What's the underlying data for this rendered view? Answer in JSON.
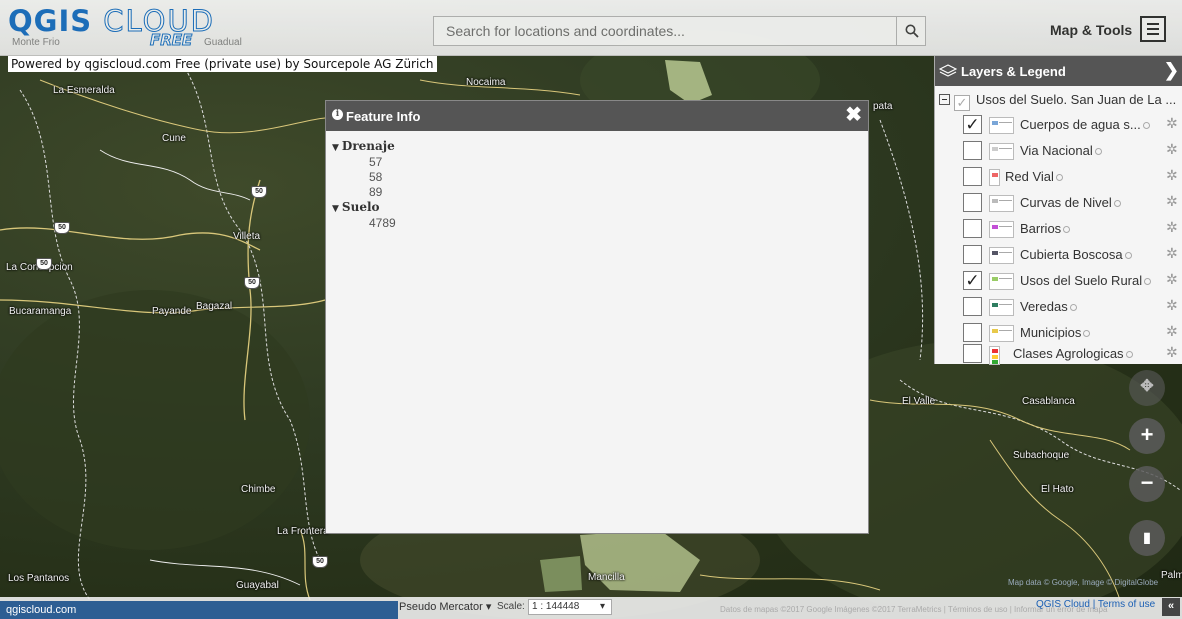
{
  "header": {
    "logo_text": "QGIS",
    "logo_cloud": "CLOUD",
    "logo_free": "FREE",
    "overlay_left": "Monte Frio",
    "overlay_right": "Guadual",
    "search_placeholder": "Search for locations and coordinates...",
    "map_tools_label": "Map & Tools"
  },
  "attribution": "Powered by qgiscloud.com Free (private use) by Sourcepole AG Zürich",
  "feature_info": {
    "title": "Feature Info",
    "groups": [
      {
        "name": "Drenaje",
        "values": [
          "57",
          "58",
          "89"
        ]
      },
      {
        "name": "Suelo",
        "values": [
          "4789"
        ]
      }
    ]
  },
  "layers_panel": {
    "title": "Layers & Legend",
    "root_label": "Usos del Suelo. San Juan de La ...",
    "layers": [
      {
        "name": "Cuerpos de agua s...",
        "checked": true
      },
      {
        "name": "Via Nacional",
        "checked": false
      },
      {
        "name": "Red Vial",
        "checked": false
      },
      {
        "name": "Curvas de Nivel",
        "checked": false
      },
      {
        "name": "Barrios",
        "checked": false
      },
      {
        "name": "Cubierta Boscosa",
        "checked": false
      },
      {
        "name": "Usos del Suelo Rural",
        "checked": true
      },
      {
        "name": "Veredas",
        "checked": false
      },
      {
        "name": "Municipios",
        "checked": false
      },
      {
        "name": "Clases Agrologicas",
        "checked": false
      }
    ]
  },
  "map_labels": {
    "la_esmeralda": "La Esmeralda",
    "nocaima": "Nocaima",
    "cune": "Cune",
    "villeta": "Villeta",
    "la_concepcion": "La Concepcion",
    "bucaramanga": "Bucaramanga",
    "payande": "Payande",
    "bagazal": "Bagazal",
    "chimbe": "Chimbe",
    "la_frontera": "La Frontera",
    "los_pantanos": "Los Pantanos",
    "guayabal": "Guayabal",
    "mancilla": "Mancilla",
    "el_valle": "El Valle",
    "casablanca": "Casablanca",
    "subachoque": "Subachoque",
    "el_hato": "El Hato",
    "pata": "pata",
    "palm": "Palm"
  },
  "road_shields": [
    "50",
    "50",
    "50",
    "50",
    "50"
  ],
  "footer": {
    "url": "qgiscloud.com",
    "crs": "Pseudo Mercator",
    "scale_label": "Scale:",
    "scale_value": "1 : 144448",
    "copyright": "Datos de mapas ©2017 Google Imágenes ©2017 TerraMetrics | Términos de uso | Informar un error de mapa",
    "links": "QGIS Cloud | Terms of use",
    "map_data": "Map data © Google, Image © DigitalGlobe"
  },
  "colors": {
    "header_blue": "#1a73c9",
    "panel_dark": "#555555",
    "footer_blue": "#2d5e93"
  }
}
